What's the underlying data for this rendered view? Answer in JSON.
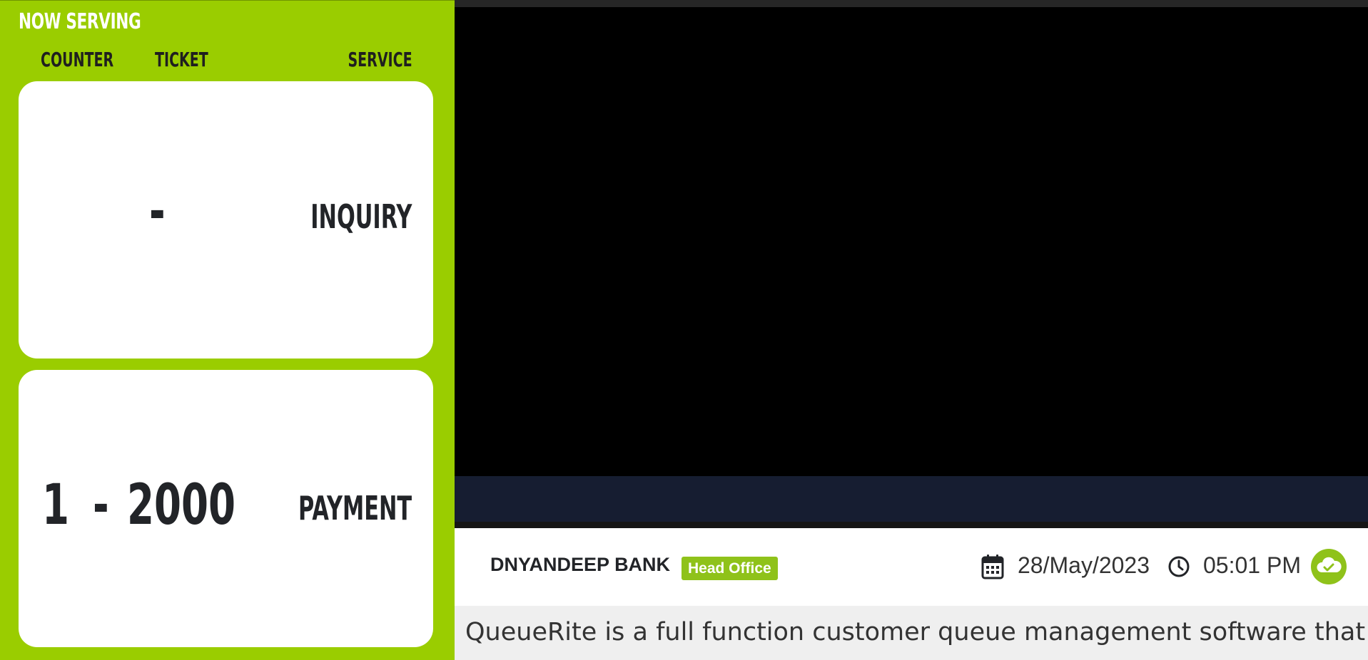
{
  "panel": {
    "heading": "NOW SERVING",
    "columns": {
      "counter": "COUNTER",
      "ticket": "TICKET",
      "service": "SERVICE"
    },
    "rows": [
      {
        "counter": "",
        "separator": "-",
        "ticket": "",
        "service": "INQUIRY"
      },
      {
        "counter": "1",
        "separator": "-",
        "ticket": "2000",
        "service": "PAYMENT"
      }
    ]
  },
  "info_bar": {
    "bank_name": "DNYANDEEP BANK",
    "branch": "Head Office",
    "date": "28/May/2023",
    "time": "05:01 PM",
    "icons": {
      "calendar": "calendar-icon",
      "clock": "clock-icon",
      "status": "cloud-check-icon"
    }
  },
  "ticker": {
    "text": "QueueRite is a full function customer queue management software that ca"
  },
  "colors": {
    "panel_green": "#9acd00",
    "badge_green": "#8fc21a",
    "navy": "#161d31",
    "text_dark": "#222428"
  }
}
